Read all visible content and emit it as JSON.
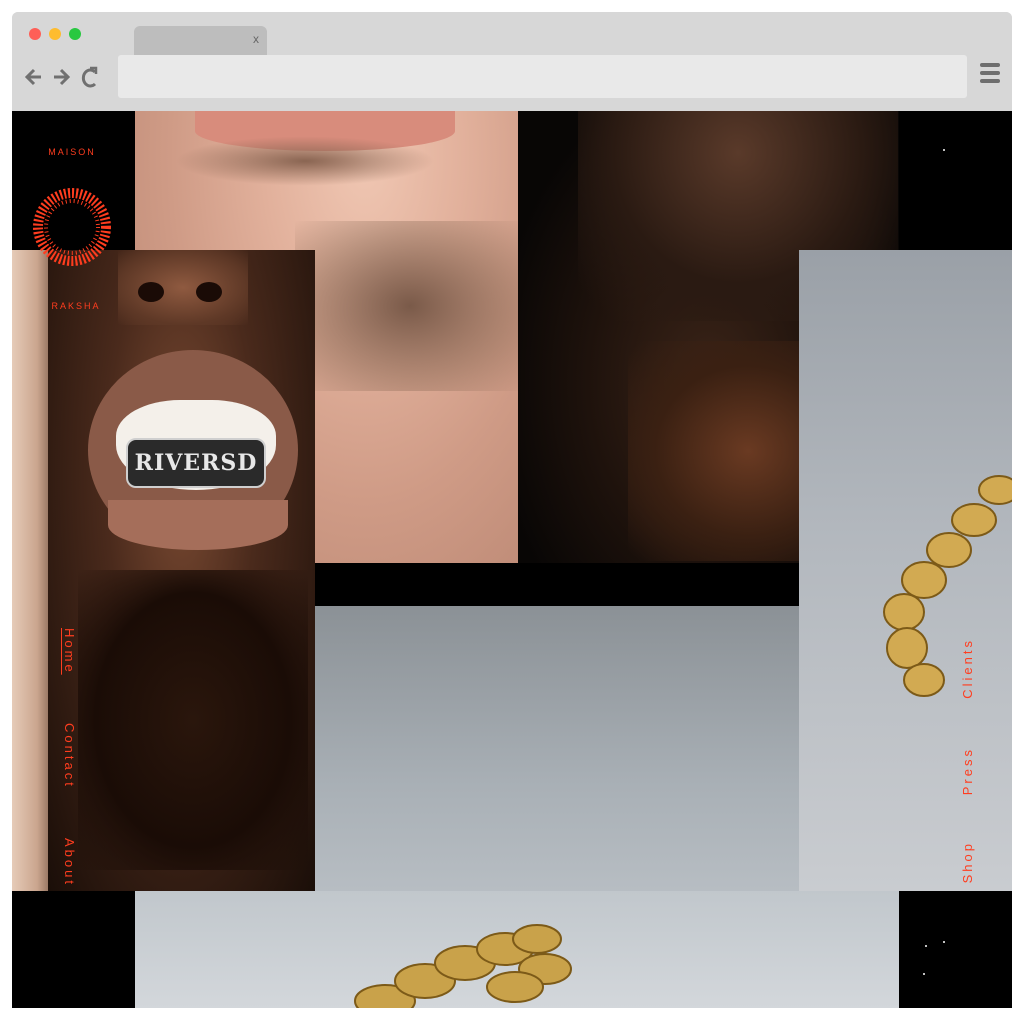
{
  "browser": {
    "tab_close": "x",
    "traffic_lights": [
      "#fe5f57",
      "#febc2e",
      "#28c840"
    ],
    "back_icon": "arrow-left-icon",
    "forward_icon": "arrow-right-icon",
    "reload_icon": "reload-icon",
    "menu_icon": "hamburger-menu-icon"
  },
  "brand": {
    "top_text": "MAISON",
    "bottom_text": "RAKSHA",
    "accent": "#ff3d1f"
  },
  "nav_left": [
    "Home",
    "Contact",
    "About"
  ],
  "nav_right": [
    "Clients",
    "Press",
    "Shop"
  ],
  "photos": {
    "grill_text": "RIVERSD"
  }
}
